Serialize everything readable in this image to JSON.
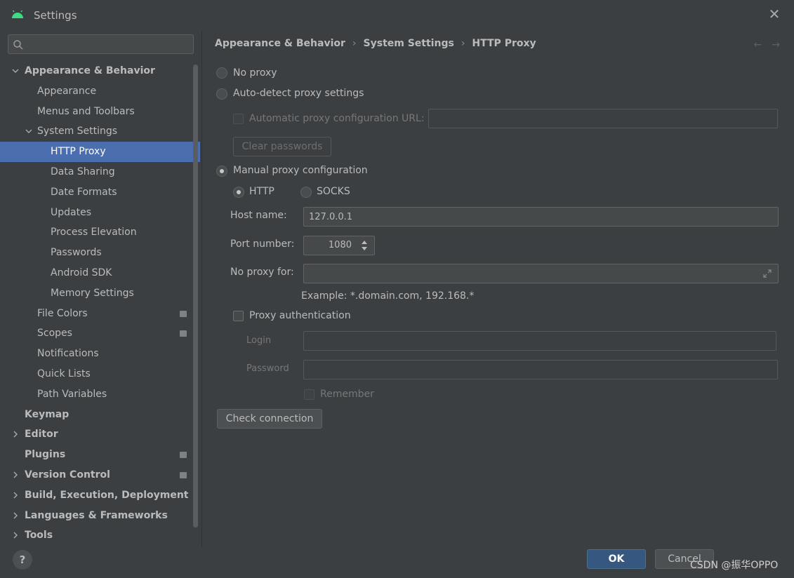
{
  "window": {
    "title": "Settings",
    "close_glyph": "✕"
  },
  "search": {
    "placeholder": "",
    "value": ""
  },
  "tree": [
    {
      "label": "Appearance & Behavior",
      "level": 0,
      "bold": true,
      "arrow": "down"
    },
    {
      "label": "Appearance",
      "level": 1
    },
    {
      "label": "Menus and Toolbars",
      "level": 1
    },
    {
      "label": "System Settings",
      "level": 1,
      "arrow": "down"
    },
    {
      "label": "HTTP Proxy",
      "level": 2,
      "selected": true
    },
    {
      "label": "Data Sharing",
      "level": 2
    },
    {
      "label": "Date Formats",
      "level": 2
    },
    {
      "label": "Updates",
      "level": 2
    },
    {
      "label": "Process Elevation",
      "level": 2
    },
    {
      "label": "Passwords",
      "level": 2
    },
    {
      "label": "Android SDK",
      "level": 2
    },
    {
      "label": "Memory Settings",
      "level": 2
    },
    {
      "label": "File Colors",
      "level": 1,
      "badge": true
    },
    {
      "label": "Scopes",
      "level": 1,
      "badge": true
    },
    {
      "label": "Notifications",
      "level": 1
    },
    {
      "label": "Quick Lists",
      "level": 1
    },
    {
      "label": "Path Variables",
      "level": 1
    },
    {
      "label": "Keymap",
      "level": 0,
      "bold": true
    },
    {
      "label": "Editor",
      "level": 0,
      "bold": true,
      "arrow": "right"
    },
    {
      "label": "Plugins",
      "level": 0,
      "bold": true,
      "badge": true
    },
    {
      "label": "Version Control",
      "level": 0,
      "bold": true,
      "arrow": "right",
      "badge": true
    },
    {
      "label": "Build, Execution, Deployment",
      "level": 0,
      "bold": true,
      "arrow": "right"
    },
    {
      "label": "Languages & Frameworks",
      "level": 0,
      "bold": true,
      "arrow": "right"
    },
    {
      "label": "Tools",
      "level": 0,
      "bold": true,
      "arrow": "right"
    }
  ],
  "breadcrumb": [
    "Appearance & Behavior",
    "System Settings",
    "HTTP Proxy"
  ],
  "nav": {
    "back": "←",
    "forward": "→"
  },
  "proxy": {
    "no_proxy_label": "No proxy",
    "auto_detect_label": "Auto-detect proxy settings",
    "auto_config_url_label": "Automatic proxy configuration URL:",
    "auto_config_url_value": "",
    "clear_passwords_label": "Clear passwords",
    "manual_label": "Manual proxy configuration",
    "selected_mode": "manual",
    "http_label": "HTTP",
    "socks_label": "SOCKS",
    "selected_type": "HTTP",
    "host_label": "Host name:",
    "host_value": "127.0.0.1",
    "port_label": "Port number:",
    "port_value": "1080",
    "no_proxy_for_label": "No proxy for:",
    "no_proxy_for_value": "",
    "example_text": "Example: *.domain.com, 192.168.*",
    "auth_label": "Proxy authentication",
    "auth_checked": false,
    "login_label": "Login",
    "password_label": "Password",
    "remember_label": "Remember",
    "check_connection_label": "Check connection"
  },
  "footer": {
    "help_label": "?",
    "ok_label": "OK",
    "cancel_label": "Cancel",
    "watermark": "CSDN @振华OPPO"
  },
  "colors": {
    "background": "#3c3f41",
    "selection": "#4b6eaf",
    "primary_button": "#365880",
    "text": "#bbbbbb"
  }
}
